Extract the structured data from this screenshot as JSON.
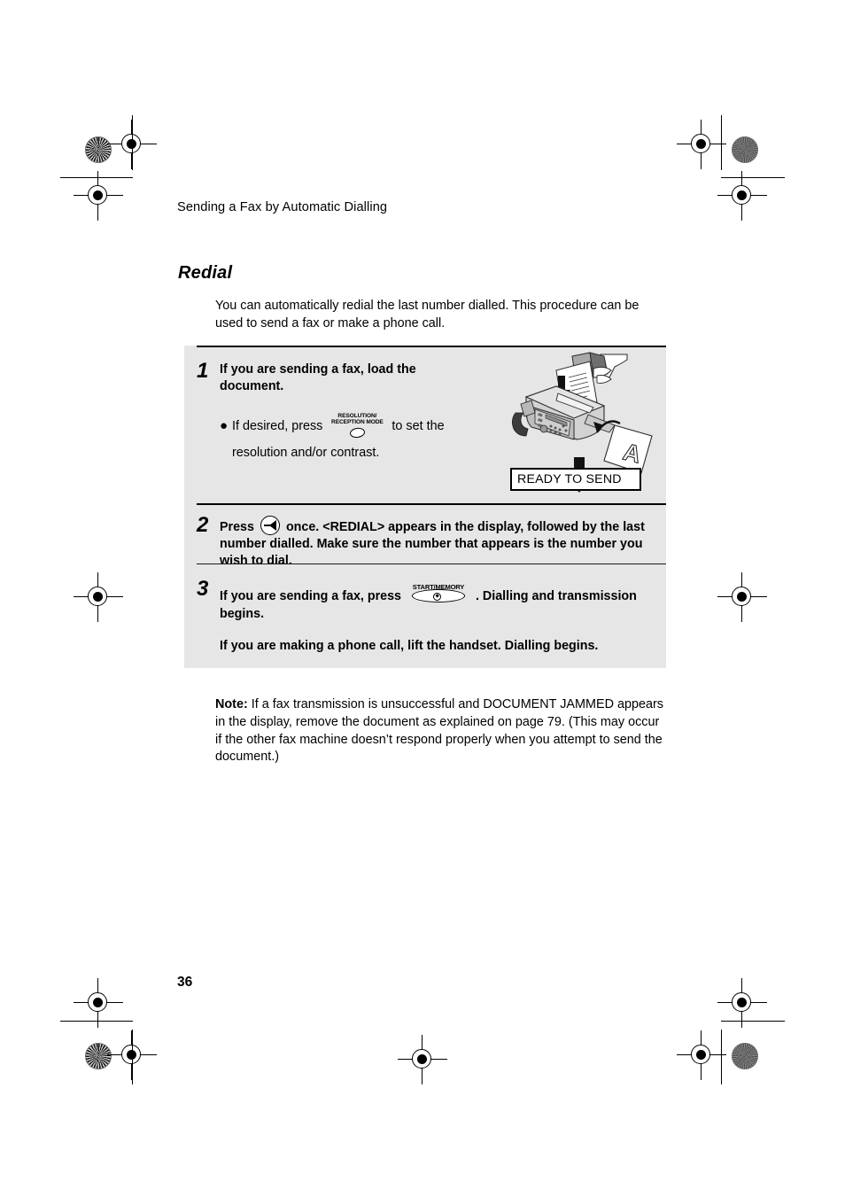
{
  "page": {
    "running_head": "Sending a Fax by Automatic Dialling",
    "section_title": "Redial",
    "intro": "You can automatically redial the last number dialled. This procedure can be used to send a fax or make a phone call.",
    "page_number": "36",
    "panel_bg": "#e6e6e6"
  },
  "steps": [
    {
      "number": "1",
      "line1": "If you are sending a fax, load the",
      "line2": "document.",
      "bullet_pre": "If desired, press",
      "bullet_post": "to set the",
      "bullet_line2": "resolution and/or contrast.",
      "key": {
        "name": "resolution-reception-mode-key",
        "label_line1": "RESOLUTION/",
        "label_line2": "RECEPTION MODE"
      }
    },
    {
      "number": "2",
      "text_pre": "Press",
      "text_post": "once. <REDIAL> appears in the display, followed by the last number dialled. Make sure the number that appears is the number you wish to dial.",
      "key": {
        "name": "redial-speaker-key"
      }
    },
    {
      "number": "3",
      "text_pre": "If you are sending a fax, press",
      "text_post": ". Dialling and transmission begins.",
      "extra_line": "If you are making a phone call, lift the handset. Dialling begins.",
      "key": {
        "name": "start-memory-key",
        "label": "START/MEMORY"
      }
    }
  ],
  "illustration": {
    "name": "fax-loading-document-illustration",
    "display_text": "READY TO SEND"
  },
  "note": {
    "label": "Note:",
    "text": " If a fax transmission is unsuccessful and DOCUMENT JAMMED appears in the display, remove the document as explained on page 79.  (This may occur if the other fax machine doesn’t respond properly when you attempt to send the document.)"
  }
}
